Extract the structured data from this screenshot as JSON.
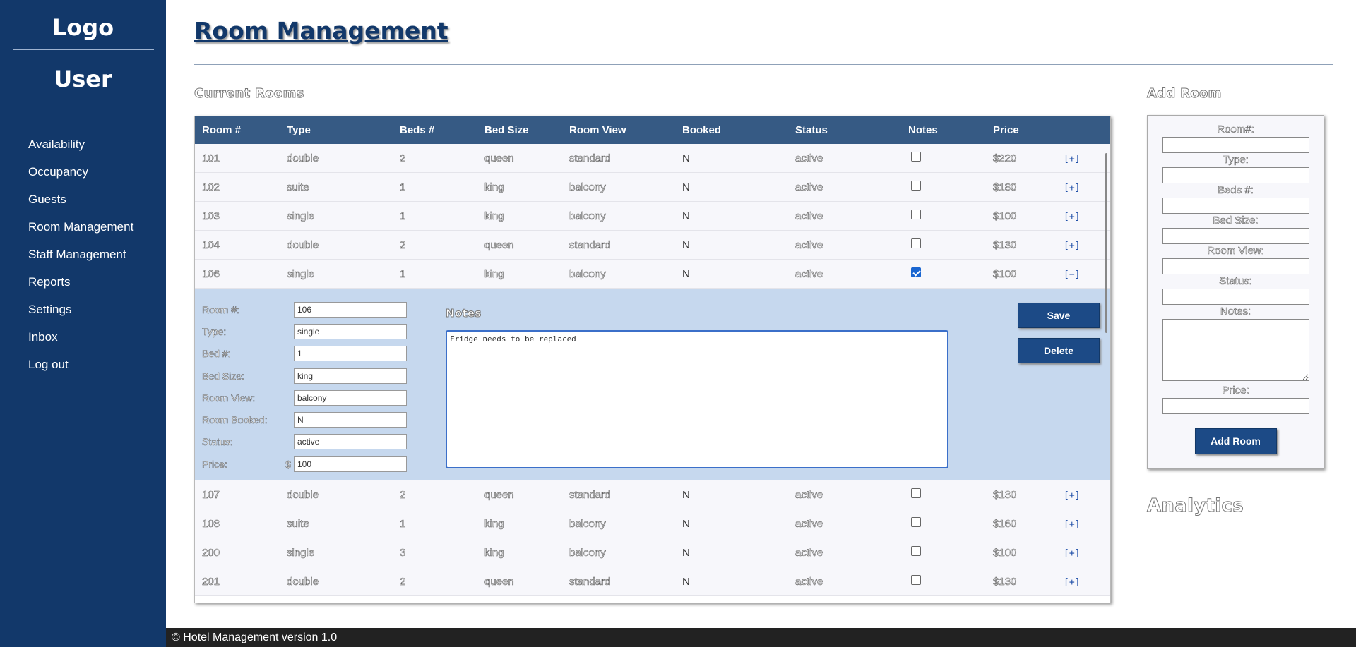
{
  "sidebar": {
    "logo": "Logo",
    "user": "User",
    "nav": [
      "Availability",
      "Occupancy",
      "Guests",
      "Room Management",
      "Staff Management",
      "Reports",
      "Settings",
      "Inbox",
      "Log out"
    ]
  },
  "page": {
    "title": "Room Management",
    "current_rooms_title": "Current Rooms",
    "add_room_title": "Add Room",
    "analytics_title": "Analytics"
  },
  "table": {
    "headers": [
      "Room #",
      "Type",
      "Beds #",
      "Bed Size",
      "Room View",
      "Booked",
      "Status",
      "Notes",
      "Price"
    ],
    "rows": [
      {
        "room": "101",
        "type": "double",
        "beds": "2",
        "size": "queen",
        "view": "standard",
        "booked": "N",
        "status": "active",
        "notes": false,
        "price": "$220",
        "toggle": "[+]"
      },
      {
        "room": "102",
        "type": "suite",
        "beds": "1",
        "size": "king",
        "view": "balcony",
        "booked": "N",
        "status": "active",
        "notes": false,
        "price": "$180",
        "toggle": "[+]"
      },
      {
        "room": "103",
        "type": "single",
        "beds": "1",
        "size": "king",
        "view": "balcony",
        "booked": "N",
        "status": "active",
        "notes": false,
        "price": "$100",
        "toggle": "[+]"
      },
      {
        "room": "104",
        "type": "double",
        "beds": "2",
        "size": "queen",
        "view": "standard",
        "booked": "N",
        "status": "active",
        "notes": false,
        "price": "$130",
        "toggle": "[+]"
      },
      {
        "room": "106",
        "type": "single",
        "beds": "1",
        "size": "king",
        "view": "balcony",
        "booked": "N",
        "status": "active",
        "notes": true,
        "price": "$100",
        "toggle": "[−]"
      },
      {
        "room": "107",
        "type": "double",
        "beds": "2",
        "size": "queen",
        "view": "standard",
        "booked": "N",
        "status": "active",
        "notes": false,
        "price": "$130",
        "toggle": "[+]"
      },
      {
        "room": "108",
        "type": "suite",
        "beds": "1",
        "size": "king",
        "view": "balcony",
        "booked": "N",
        "status": "active",
        "notes": false,
        "price": "$160",
        "toggle": "[+]"
      },
      {
        "room": "200",
        "type": "single",
        "beds": "3",
        "size": "king",
        "view": "balcony",
        "booked": "N",
        "status": "active",
        "notes": false,
        "price": "$100",
        "toggle": "[+]"
      },
      {
        "room": "201",
        "type": "double",
        "beds": "2",
        "size": "queen",
        "view": "standard",
        "booked": "N",
        "status": "active",
        "notes": false,
        "price": "$130",
        "toggle": "[+]"
      }
    ]
  },
  "edit": {
    "fields": [
      {
        "label": "Room #:",
        "prefix": "",
        "value": "106"
      },
      {
        "label": "Type:",
        "prefix": "",
        "value": "single"
      },
      {
        "label": "Bed #:",
        "prefix": "",
        "value": "1"
      },
      {
        "label": "Bed Size:",
        "prefix": "",
        "value": "king"
      },
      {
        "label": "Room View:",
        "prefix": "",
        "value": "balcony"
      },
      {
        "label": "Room Booked:",
        "prefix": "",
        "value": "N"
      },
      {
        "label": "Status:",
        "prefix": "",
        "value": "active"
      },
      {
        "label": "Price:",
        "prefix": "$",
        "value": "100"
      }
    ],
    "notes_label": "Notes",
    "notes_value": "Fridge needs to be replaced",
    "save_label": "Save",
    "delete_label": "Delete"
  },
  "add_form": {
    "labels": [
      "Room#:",
      "Type:",
      "Beds #:",
      "Bed Size:",
      "Room View:",
      "Status:"
    ],
    "notes_label": "Notes:",
    "price_label": "Price:",
    "button_label": "Add Room"
  },
  "footer": {
    "text": "© Hotel Management version 1.0"
  }
}
